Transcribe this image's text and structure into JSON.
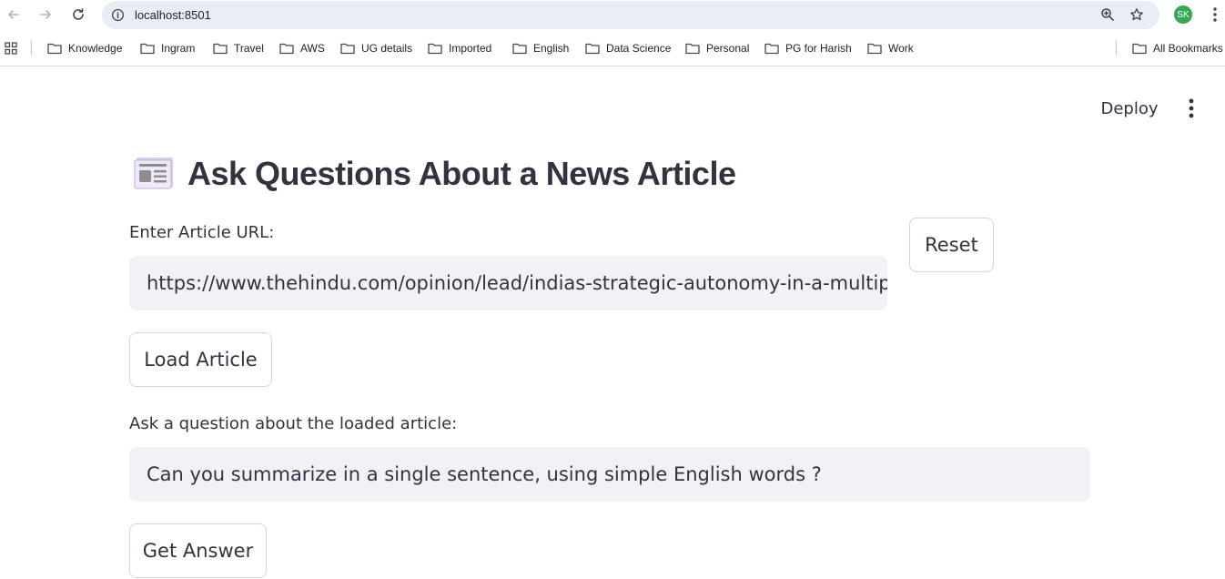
{
  "browser": {
    "url": "localhost:8501",
    "profile_initials": "SK",
    "bookmarks": [
      "Knowledge",
      "Ingram",
      "Travel",
      "AWS",
      "UG details",
      "Imported",
      "English",
      "Data Science",
      "Personal",
      "PG for Harish",
      "Work"
    ],
    "all_bookmarks_label": "All Bookmarks"
  },
  "app": {
    "deploy_label": "Deploy",
    "title_icon": "newspaper-icon",
    "title": "Ask Questions About a News Article",
    "url_label": "Enter Article URL:",
    "url_value": "https://www.thehindu.com/opinion/lead/indias-strategic-autonomy-in-a-multip",
    "reset_label": "Reset",
    "load_label": "Load Article",
    "question_label": "Ask a question about the loaded article:",
    "question_value": "Can you summarize in a single sentence, using simple English words ?",
    "answer_label": "Get Answer"
  },
  "colors": {
    "accent": "#34a853",
    "input_bg": "#f0f2f6",
    "text": "#31333f"
  }
}
